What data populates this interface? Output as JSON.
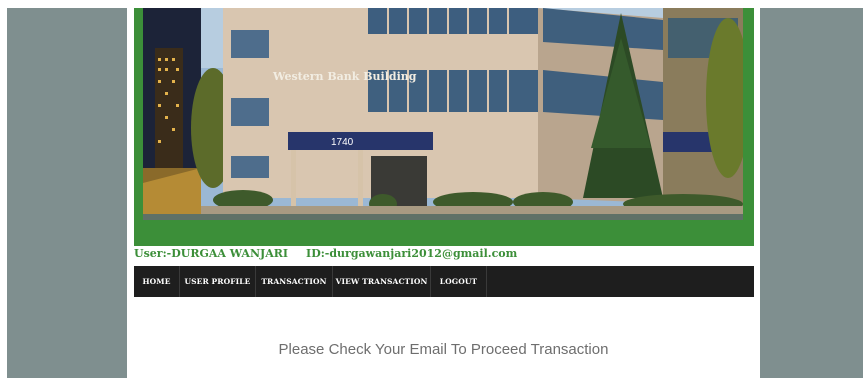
{
  "banner": {
    "sign_text": "Western Bank Building",
    "canopy_number": "1740",
    "alt_label": "bank building photo"
  },
  "user": {
    "name_label": "User:-DURGAA WANJARI",
    "id_label": "ID:-durgawanjari2012@gmail.com"
  },
  "nav": {
    "items": [
      "HOME",
      "USER PROFILE",
      "TRANSACTION",
      "VIEW TRANSACTION",
      "LOGOUT"
    ]
  },
  "main": {
    "message": "Please Check Your Email To Proceed Transaction"
  },
  "colors": {
    "accent_green": "#3c8f39",
    "side_gray": "#7f8f8f",
    "nav_bg": "#1e1e1e"
  }
}
